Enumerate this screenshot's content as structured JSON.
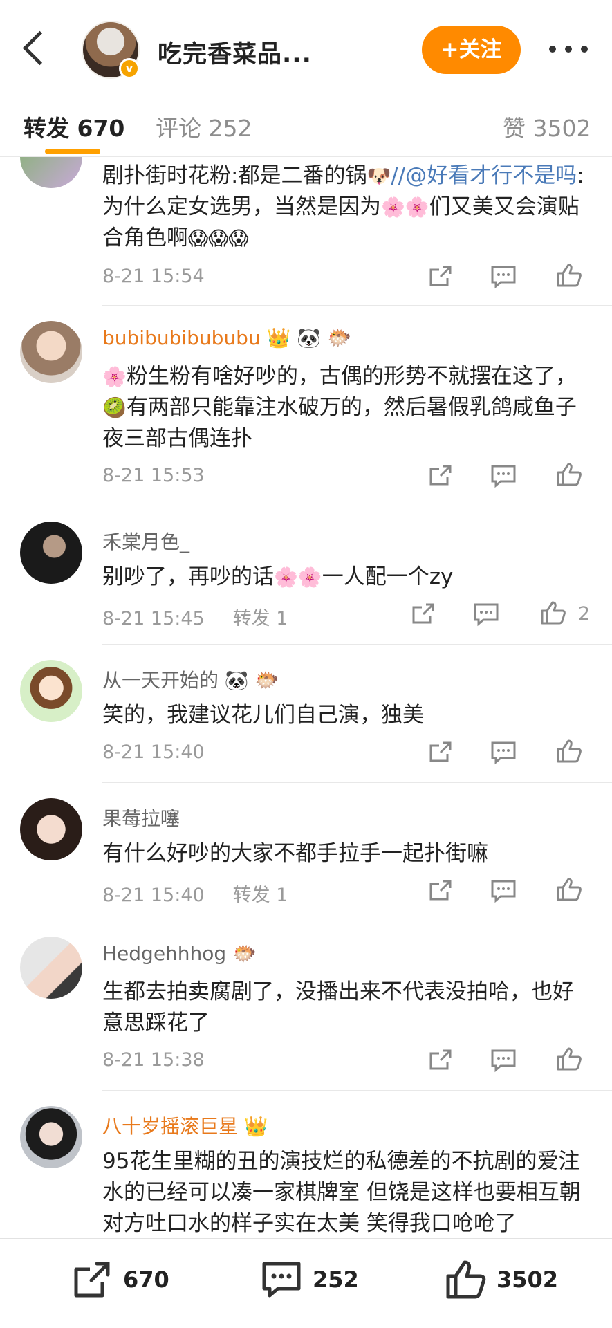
{
  "header": {
    "title": "吃完香菜品...",
    "follow_label": "+关注",
    "verified_mark": "v"
  },
  "tabs": [
    {
      "label": "转发 670"
    },
    {
      "label": "评论 252"
    },
    {
      "label": "赞 3502"
    }
  ],
  "comments": [
    {
      "user": "",
      "text_a": "剧扑街时花粉:都是二番的锅",
      "text_mention": "//@好看才行不是吗",
      "text_b": ":为什么定女选男，当然是因为",
      "text_c": "们又美又会演贴合角色啊",
      "time": "8-21 15:54",
      "emojis": [
        "🐶",
        "🌸",
        "🌸",
        "😱",
        "😱",
        "😱"
      ]
    },
    {
      "user": "bubibubibububu",
      "text_a": "粉生粉有啥好吵的，古偶的形势不就摆在这了，",
      "text_b": "有两部只能靠注水破万的，然后暑假乳鸽咸鱼子夜三部古偶连扑",
      "time": "8-21 15:53",
      "emojis": [
        "👑",
        "🐼",
        "🐡",
        "🌸",
        "🥝"
      ]
    },
    {
      "user": "禾棠月色_",
      "text_a": "别吵了，再吵的话",
      "text_b": "一人配一个zy",
      "time": "8-21 15:45",
      "repost": "转发 1",
      "likes": "2",
      "emojis": [
        "🌸",
        "🌸"
      ]
    },
    {
      "user": "从一天开始的",
      "text_a": "笑的，我建议花儿们自己演，独美",
      "time": "8-21 15:40",
      "emojis": [
        "🐼",
        "🐡"
      ]
    },
    {
      "user": "果莓拉噻",
      "text_a": "有什么好吵的大家不都手拉手一起扑街嘛",
      "time": "8-21 15:40",
      "repost": "转发 1"
    },
    {
      "user": "Hedgehhhog",
      "text_a": "生都去拍卖腐剧了，没播出来不代表没拍哈，也好意思踩花了",
      "time": "8-21 15:38",
      "emojis": [
        "🐡"
      ]
    },
    {
      "user": "八十岁摇滚巨星",
      "text_a": "95花生里糊的丑的演技烂的私德差的不抗剧的爱注水的已经可以凑一家棋牌室 但饶是这样也要相互朝对方吐口水的样子实在太美 笑得我口呛呛了",
      "emojis": [
        "👑"
      ]
    }
  ],
  "bottom": {
    "repost_count": "670",
    "comment_count": "252",
    "like_count": "3502"
  },
  "icons": {
    "repost": "share-icon",
    "comment": "comment-icon",
    "like": "thumbs-up-icon"
  },
  "colors": {
    "accent": "#ff8a00",
    "vip_name": "#e8791b",
    "mention": "#4a7ab8",
    "meta": "#9a9a9a"
  }
}
